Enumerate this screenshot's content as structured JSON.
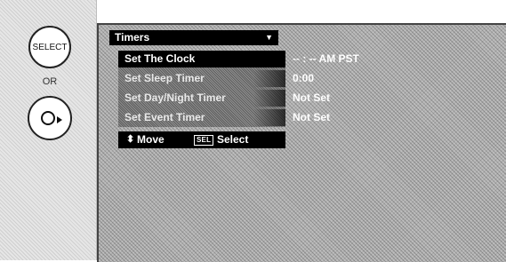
{
  "remote": {
    "select_button_label": "SELECT",
    "or_label": "OR"
  },
  "menu": {
    "title": "Timers",
    "items": [
      {
        "label": "Set The Clock",
        "value": "-- : -- AM PST"
      },
      {
        "label": "Set Sleep Timer",
        "value": "0:00"
      },
      {
        "label": "Set Day/Night Timer",
        "value": "Not Set"
      },
      {
        "label": "Set Event Timer",
        "value": "Not Set"
      }
    ]
  },
  "footer": {
    "move_label": "Move",
    "sel_icon_label": "SEL",
    "select_label": "Select"
  },
  "icons": {
    "move": "up-down-arrows-icon",
    "right_arrow": "right-arrow-icon",
    "dropdown": "triangle-down-icon"
  },
  "colors": {
    "header_bg": "#000000",
    "selected_bg": "#000000",
    "text_light": "#ffffff"
  }
}
